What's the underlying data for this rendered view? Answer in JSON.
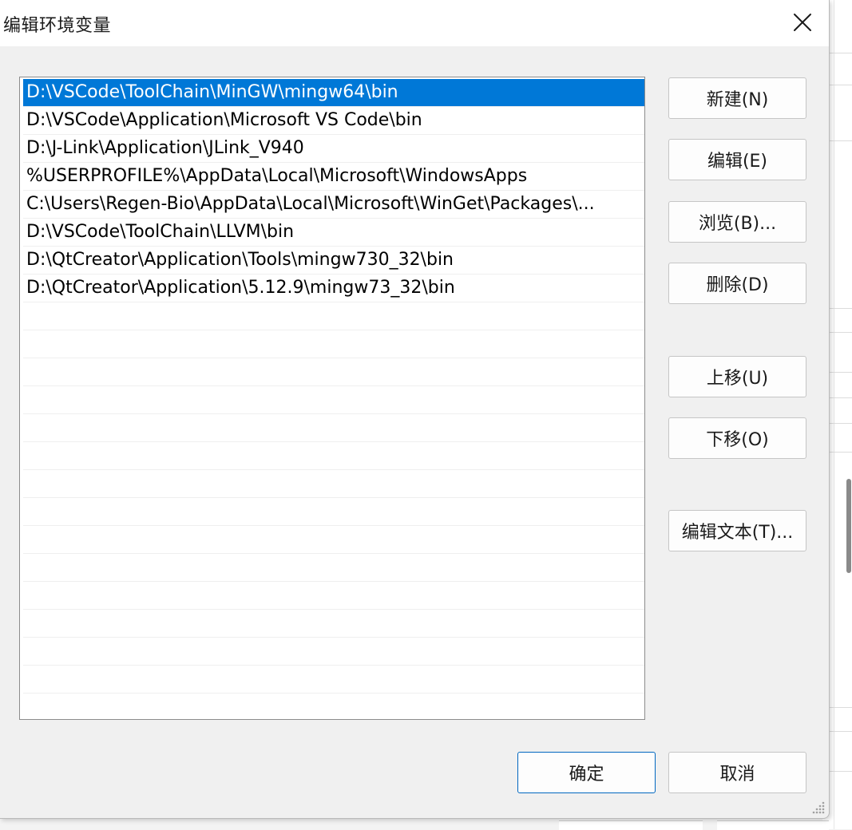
{
  "dialog": {
    "title": "编辑环境变量"
  },
  "path_list": {
    "selected_index": 0,
    "items": [
      "D:\\VSCode\\ToolChain\\MinGW\\mingw64\\bin",
      "D:\\VSCode\\Application\\Microsoft VS Code\\bin",
      "D:\\J-Link\\Application\\JLink_V940",
      "%USERPROFILE%\\AppData\\Local\\Microsoft\\WindowsApps",
      "C:\\Users\\Regen-Bio\\AppData\\Local\\Microsoft\\WinGet\\Packages\\...",
      "D:\\VSCode\\ToolChain\\LLVM\\bin",
      "D:\\QtCreator\\Application\\Tools\\mingw730_32\\bin",
      "D:\\QtCreator\\Application\\5.12.9\\mingw73_32\\bin"
    ]
  },
  "buttons": {
    "new": "新建(N)",
    "edit": "编辑(E)",
    "browse": "浏览(B)...",
    "delete": "删除(D)",
    "move_up": "上移(U)",
    "move_down": "下移(O)",
    "edit_text": "编辑文本(T)...",
    "ok": "确定",
    "cancel": "取消"
  },
  "colors": {
    "selection": "#0078d7",
    "primary_border": "#0067c0"
  },
  "icons": {
    "close": "close-icon",
    "resize": "resize-grip-icon"
  }
}
